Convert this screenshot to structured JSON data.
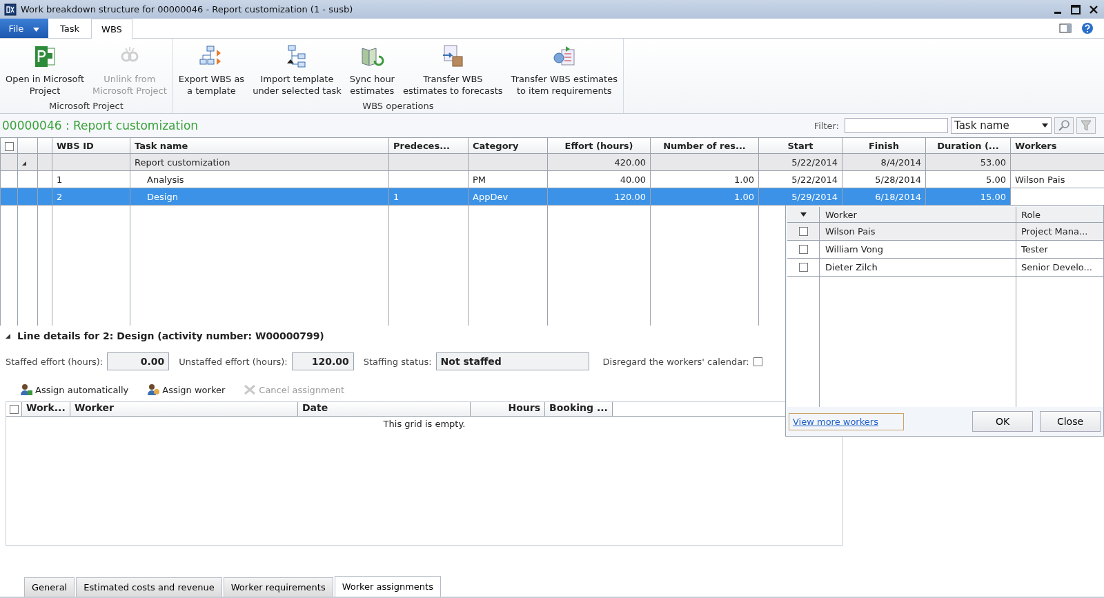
{
  "window": {
    "title": "Work breakdown structure for 00000046 - Report customization (1 - susb)"
  },
  "menu_tabs": [
    {
      "label": "File",
      "kind": "file",
      "selected": false
    },
    {
      "label": "Task",
      "kind": "tab",
      "selected": false
    },
    {
      "label": "WBS",
      "kind": "tab",
      "selected": true
    }
  ],
  "ribbon_groups": [
    {
      "label": "Microsoft Project",
      "buttons": [
        {
          "lines": [
            "Open in Microsoft",
            "Project"
          ],
          "disabled": false
        },
        {
          "lines": [
            "Unlink from",
            "Microsoft Project"
          ],
          "disabled": true
        }
      ]
    },
    {
      "label": "WBS operations",
      "buttons": [
        {
          "lines": [
            "Export WBS as",
            "a template"
          ],
          "disabled": false
        },
        {
          "lines": [
            "Import template",
            "under selected task"
          ],
          "disabled": false
        },
        {
          "lines": [
            "Sync hour",
            "estimates"
          ],
          "disabled": false
        },
        {
          "lines": [
            "Transfer WBS",
            "estimates to forecasts"
          ],
          "disabled": false
        },
        {
          "lines": [
            "Transfer WBS estimates",
            "to item requirements"
          ],
          "disabled": false
        }
      ]
    }
  ],
  "header": {
    "title": "00000046 : Report customization",
    "filter_label": "Filter:",
    "filter_field": "Task name"
  },
  "grid": {
    "select_all": {
      "checked": false
    },
    "columns": [
      "WBS ID",
      "Task name",
      "Predeces...",
      "Category",
      "Effort (hours)",
      "Number of res...",
      "Start",
      "Finish",
      "Duration (...",
      "Workers"
    ],
    "rows": [
      {
        "selected": false,
        "expanded": true,
        "cells": [
          null,
          "Report customization",
          null,
          null,
          "420.00",
          null,
          "5/22/2014",
          "8/4/2014",
          "53.00",
          null
        ],
        "children": [
          {
            "selected": false,
            "cells": [
              "1",
              "Analysis",
              null,
              "PM",
              "40.00",
              "1.00",
              "5/22/2014",
              "5/28/2014",
              "5.00",
              "Wilson Pais"
            ]
          },
          {
            "selected": true,
            "cells": [
              "2",
              "Design",
              "1",
              "AppDev",
              "120.00",
              "1.00",
              "5/29/2014",
              "6/18/2014",
              "15.00",
              null
            ]
          }
        ]
      }
    ]
  },
  "line_details": {
    "title": "Line details for 2: Design (activity number: W00000799)",
    "expanded": true,
    "fields": [
      {
        "label": "Staffed effort (hours):",
        "value": "0.00",
        "kind": "number"
      },
      {
        "label": "Unstaffed effort (hours):",
        "value": "120.00",
        "kind": "number"
      },
      {
        "label": "Staffing status:",
        "value": "Not staffed",
        "kind": "text"
      }
    ],
    "calendar_checkbox": {
      "label": "Disregard the workers' calendar:",
      "checked": false
    },
    "toolbar": [
      {
        "label": "Assign automatically",
        "disabled": false
      },
      {
        "label": "Assign worker",
        "disabled": false
      },
      {
        "label": "Cancel assignment",
        "disabled": true
      }
    ],
    "assignment_grid": {
      "select_all": {
        "checked": false
      },
      "columns": [
        "Work...",
        "Worker",
        "Date",
        "Hours",
        "Booking ..."
      ],
      "empty_text": "This grid is empty."
    }
  },
  "worker_popup": {
    "columns": [
      "Worker",
      "Role"
    ],
    "rows": [
      {
        "name": "Wilson Pais",
        "role": "Project Mana...",
        "checked": false,
        "selected": true
      },
      {
        "name": "William Vong",
        "role": "Tester",
        "checked": false,
        "selected": false
      },
      {
        "name": "Dieter Zilch",
        "role": "Senior Develo...",
        "checked": false,
        "selected": false
      }
    ],
    "link": "View more workers",
    "buttons": [
      "OK",
      "Close"
    ]
  },
  "bottom_tabs": [
    {
      "label": "General",
      "selected": false
    },
    {
      "label": "Estimated costs and revenue",
      "selected": false
    },
    {
      "label": "Worker requirements",
      "selected": false
    },
    {
      "label": "Worker assignments",
      "selected": true
    }
  ]
}
